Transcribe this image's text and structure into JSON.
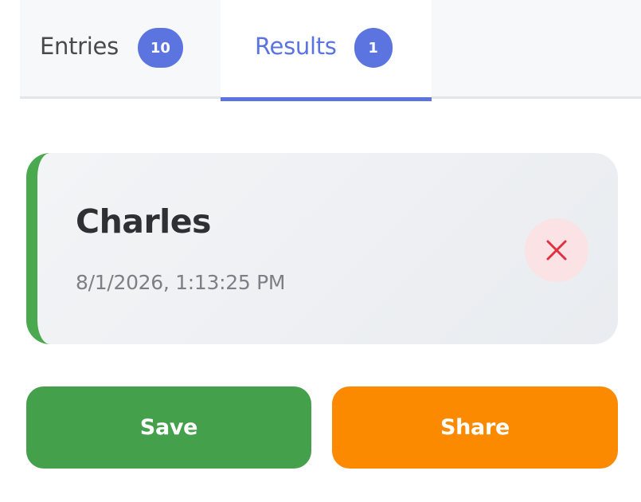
{
  "colors": {
    "accent": "#5b74e0",
    "success": "#44a04b",
    "warning": "#fb8a00",
    "danger": "#e0313f",
    "card_border": "#4aa94e"
  },
  "tabs": [
    {
      "label": "Entries",
      "count": "10",
      "active": false
    },
    {
      "label": "Results",
      "count": "1",
      "active": true
    }
  ],
  "result_card": {
    "name": "Charles",
    "timestamp": "8/1/2026, 1:13:25 PM",
    "remove_icon": "close-icon"
  },
  "actions": {
    "save_label": "Save",
    "share_label": "Share"
  }
}
